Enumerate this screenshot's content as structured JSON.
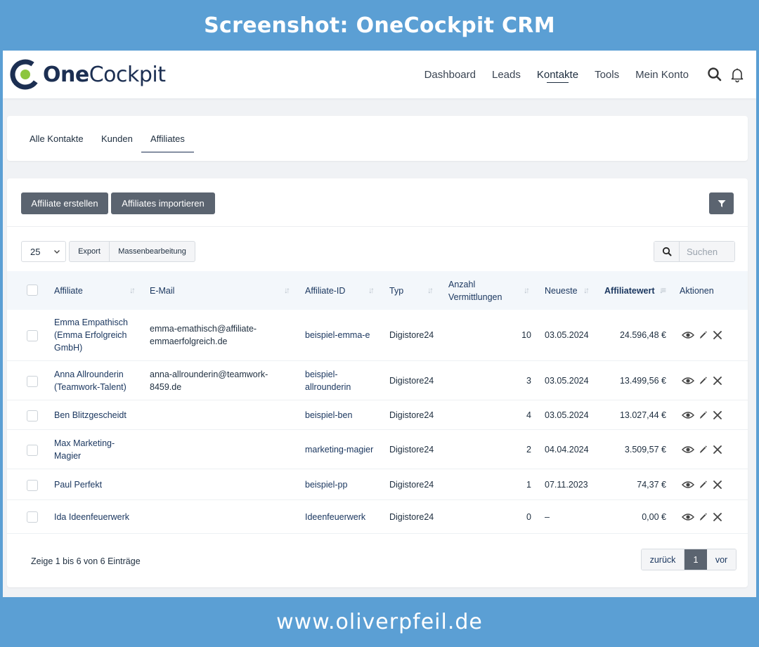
{
  "banner": {
    "title": "Screenshot: OneCockpit CRM",
    "footer": "www.oliverpfeil.de"
  },
  "brand": {
    "name_bold": "One",
    "name_regular": "Cockpit",
    "colors": {
      "navy": "#1c2f52",
      "green": "#8dc63f",
      "banner": "#5b9fd4"
    }
  },
  "nav": {
    "items": [
      {
        "label": "Dashboard",
        "active": false
      },
      {
        "label": "Leads",
        "active": false
      },
      {
        "label": "Kontakte",
        "active": true
      },
      {
        "label": "Tools",
        "active": false
      },
      {
        "label": "Mein Konto",
        "active": false
      }
    ],
    "icons": [
      "search-icon",
      "bell-icon"
    ]
  },
  "tabs": [
    {
      "label": "Alle Kontakte",
      "active": false
    },
    {
      "label": "Kunden",
      "active": false
    },
    {
      "label": "Affiliates",
      "active": true
    }
  ],
  "toolbar": {
    "create_label": "Affiliate erstellen",
    "import_label": "Affiliates importieren",
    "filter_icon": "filter-icon"
  },
  "controls": {
    "page_size": "25",
    "export_label": "Export",
    "bulk_label": "Massenbearbeitung",
    "search_placeholder": "Suchen"
  },
  "table": {
    "headers": {
      "affiliate": "Affiliate",
      "email": "E-Mail",
      "affiliate_id": "Affiliate-ID",
      "typ": "Typ",
      "anzahl": "Anzahl",
      "vermittlungen": "Vermittlungen",
      "neueste": "Neueste",
      "affiliatewert": "Affiliatewert",
      "aktionen": "Aktionen"
    },
    "rows": [
      {
        "name": "Emma Empathisch (Emma Erfolgreich GmbH)",
        "email": "emma-emathisch@affiliate-emmaerfolgreich.de",
        "affiliate_id": "beispiel-emma-e",
        "typ": "Digistore24",
        "anzahl": "10",
        "neueste": "03.05.2024",
        "wert": "24.596,48 €"
      },
      {
        "name": "Anna Allrounderin (Teamwork-Talent)",
        "email": "anna-allrounderin@teamwork-8459.de",
        "affiliate_id": "beispiel-allrounderin",
        "typ": "Digistore24",
        "anzahl": "3",
        "neueste": "03.05.2024",
        "wert": "13.499,56 €"
      },
      {
        "name": "Ben Blitzgescheidt",
        "email": "",
        "affiliate_id": "beispiel-ben",
        "typ": "Digistore24",
        "anzahl": "4",
        "neueste": "03.05.2024",
        "wert": "13.027,44 €"
      },
      {
        "name": "Max Marketing-Magier",
        "email": "",
        "affiliate_id": "marketing-magier",
        "typ": "Digistore24",
        "anzahl": "2",
        "neueste": "04.04.2024",
        "wert": "3.509,57 €"
      },
      {
        "name": "Paul Perfekt",
        "email": "",
        "affiliate_id": "beispiel-pp",
        "typ": "Digistore24",
        "anzahl": "1",
        "neueste": "07.11.2023",
        "wert": "74,37 €"
      },
      {
        "name": "Ida Ideenfeuerwerk",
        "email": "",
        "affiliate_id": "Ideenfeuerwerk",
        "typ": "Digistore24",
        "anzahl": "0",
        "neueste": "–",
        "wert": "0,00 €"
      }
    ],
    "row_actions": [
      "eye-icon",
      "pencil-icon",
      "close-icon"
    ]
  },
  "footer": {
    "entries_text": "Zeige 1 bis 6 von 6 Einträge",
    "prev_label": "zurück",
    "page_label": "1",
    "next_label": "vor"
  }
}
